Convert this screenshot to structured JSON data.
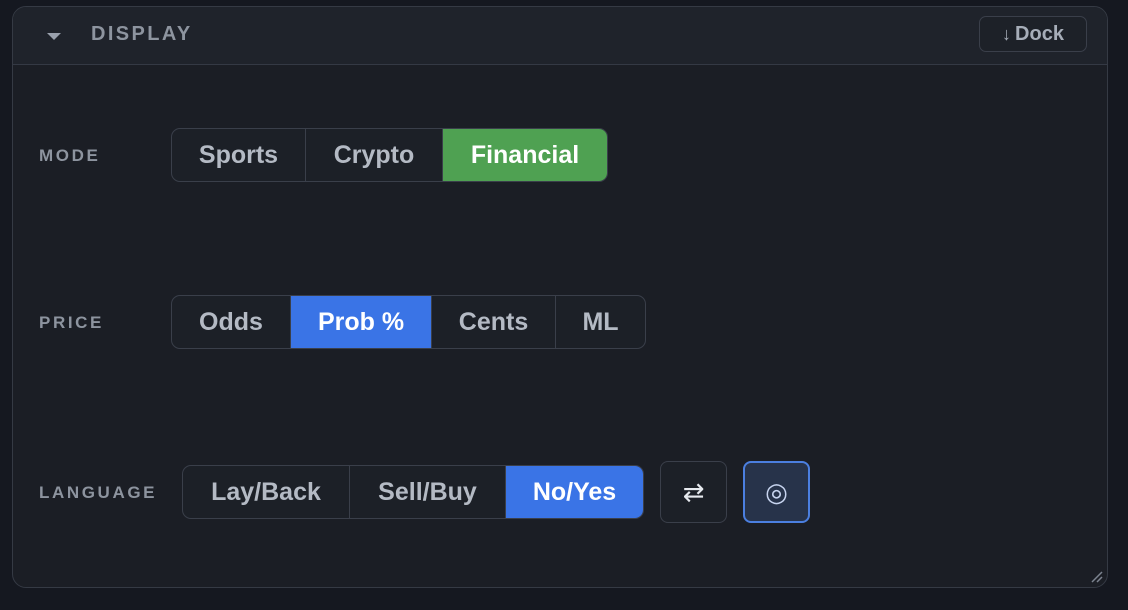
{
  "header": {
    "title": "DISPLAY",
    "dock_icon": "↓",
    "dock_label": "Dock"
  },
  "rows": {
    "mode": {
      "label": "MODE",
      "options": [
        "Sports",
        "Crypto",
        "Financial"
      ],
      "selected": "Financial"
    },
    "price": {
      "label": "PRICE",
      "options": [
        "Odds",
        "Prob %",
        "Cents",
        "ML"
      ],
      "selected": "Prob %"
    },
    "language": {
      "label": "LANGUAGE",
      "options": [
        "Lay/Back",
        "Sell/Buy",
        "No/Yes"
      ],
      "selected": "No/Yes",
      "swap_icon": "⇄",
      "target_icon": "◎"
    }
  },
  "icons": [
    "collapse-triangle-icon",
    "dock-arrow-icon",
    "swap-arrows-icon",
    "target-circle-icon",
    "resize-grip-icon"
  ],
  "colors": {
    "panel_bg": "#1b1e25",
    "accent_green": "#4fa152",
    "accent_blue": "#3a74e6",
    "label_gray": "#8d949f"
  }
}
